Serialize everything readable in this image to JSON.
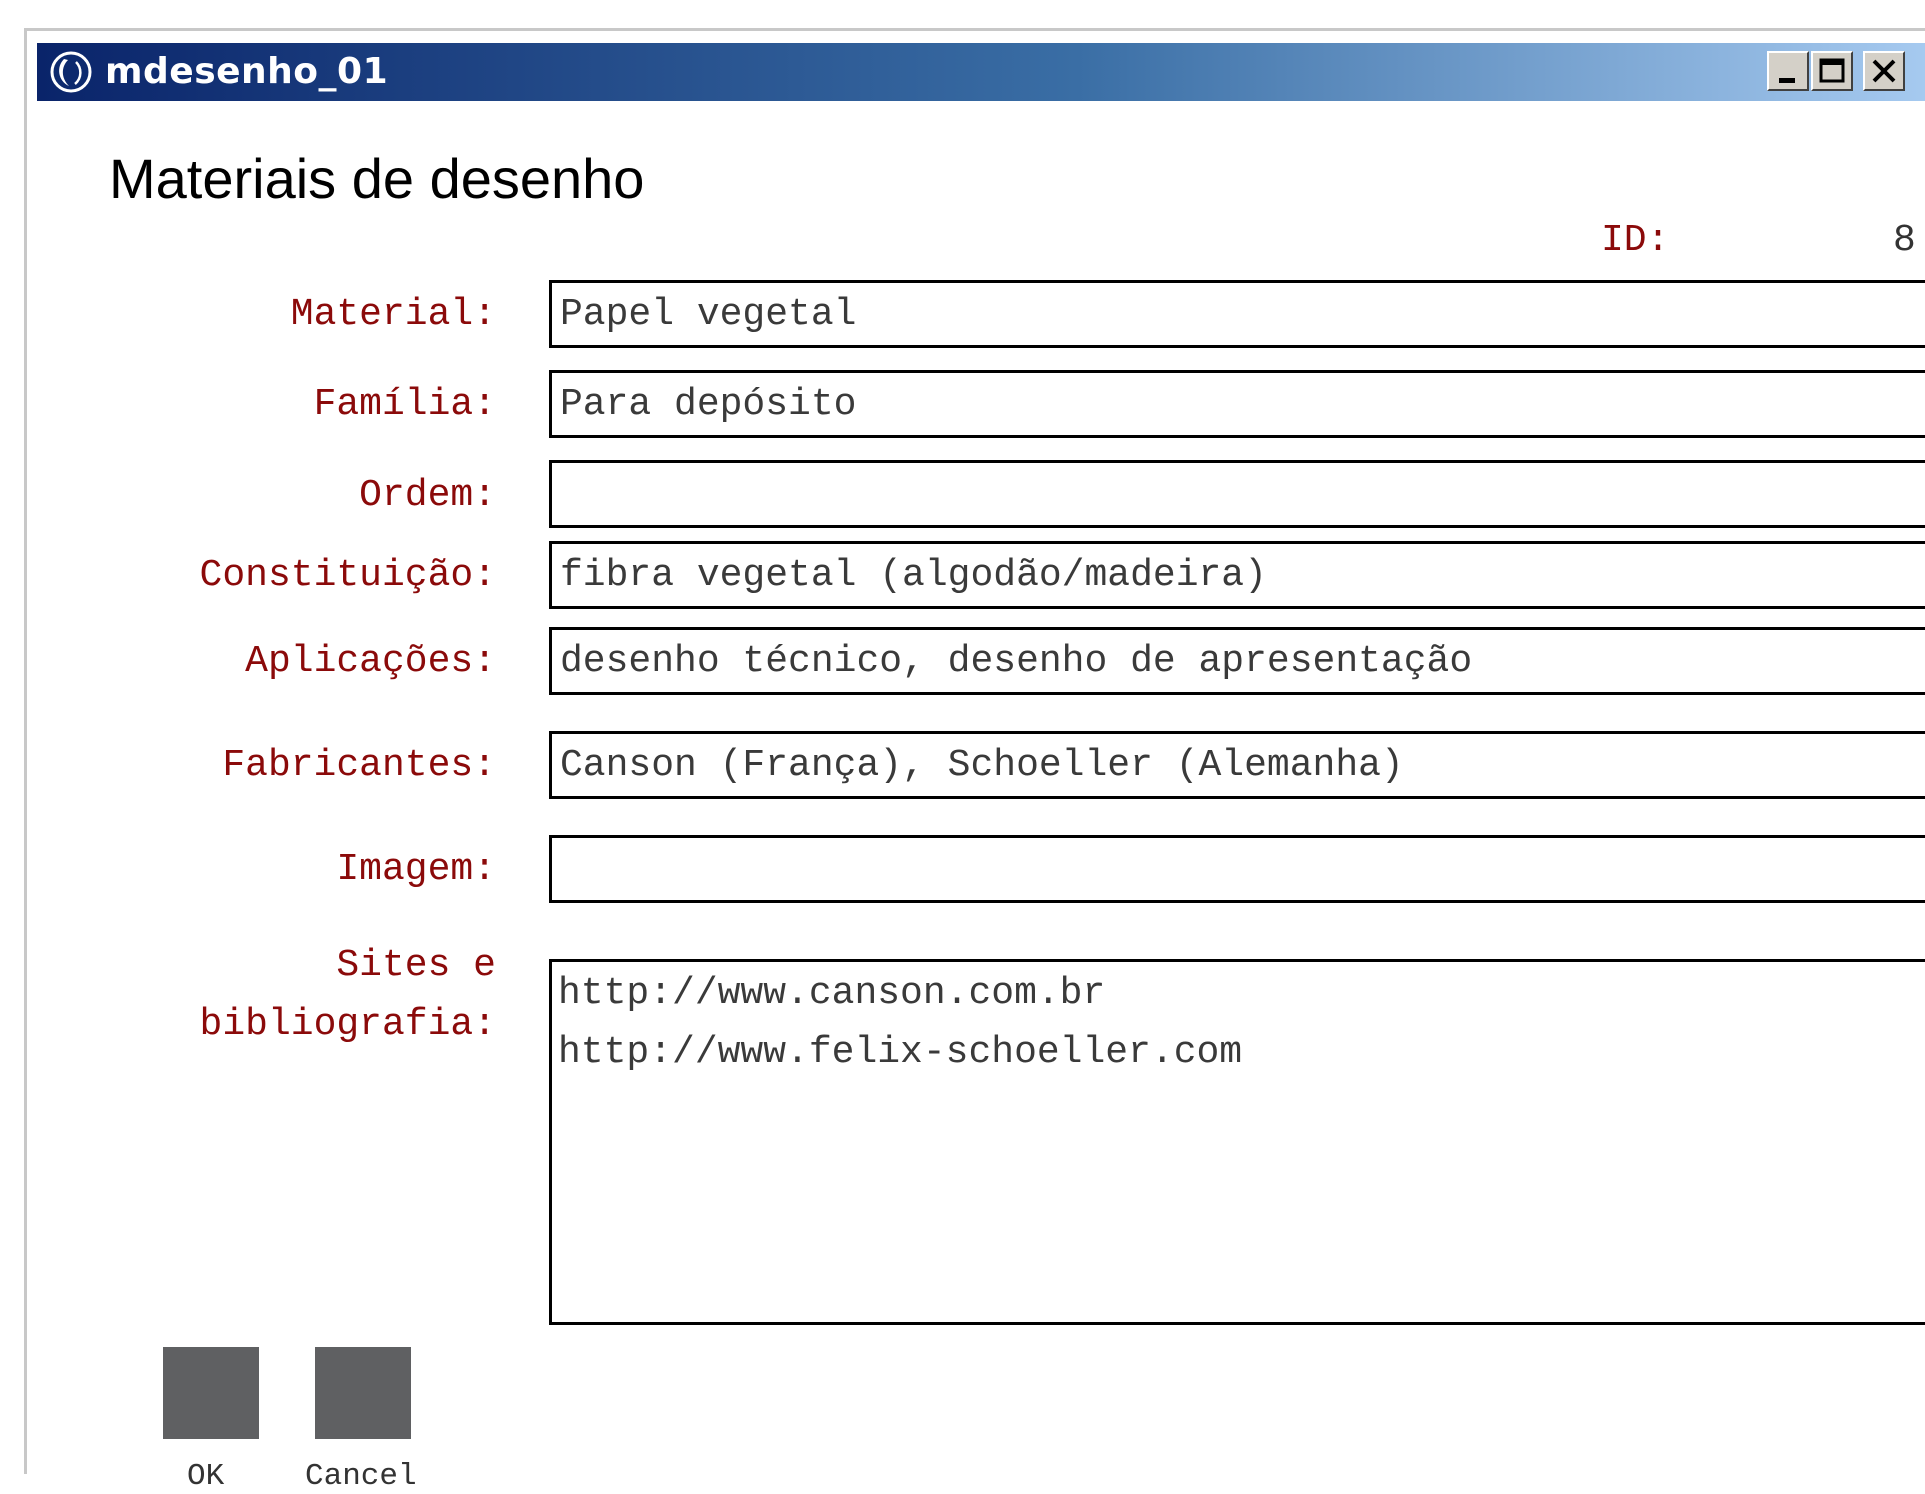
{
  "window": {
    "title": "mdesenho_01",
    "icon": "app-globe-icon",
    "controls": [
      "minimize-icon",
      "maximize-icon",
      "close-icon"
    ]
  },
  "form": {
    "title": "Materiais de desenho",
    "id_label": "ID:",
    "id_value": "8",
    "fields": [
      {
        "label": "Material:",
        "value": "Papel vegetal"
      },
      {
        "label": "Família:",
        "value": "Para depósito"
      },
      {
        "label": "Ordem:",
        "value": ""
      },
      {
        "label": "Constituição:",
        "value": "fibra vegetal (algodão/madeira)"
      },
      {
        "label": "Aplicações:",
        "value": "desenho técnico, desenho de apresentação"
      },
      {
        "label": "Fabricantes:",
        "value": "Canson (França), Schoeller (Alemanha)"
      },
      {
        "label": "Imagem:",
        "value": ""
      }
    ],
    "sites": {
      "label_line1": "Sites e",
      "label_line2": "bibliografia:",
      "lines": [
        "http://www.canson.com.br",
        "http://www.felix-schoeller.com"
      ]
    }
  },
  "actions": {
    "ok_label": "OK",
    "cancel_label": "Cancel",
    "button_color": "#5f6062"
  },
  "colors": {
    "label": "#8b0a0a",
    "titlebar_start": "#0a246a",
    "titlebar_end": "#a6caf0"
  }
}
